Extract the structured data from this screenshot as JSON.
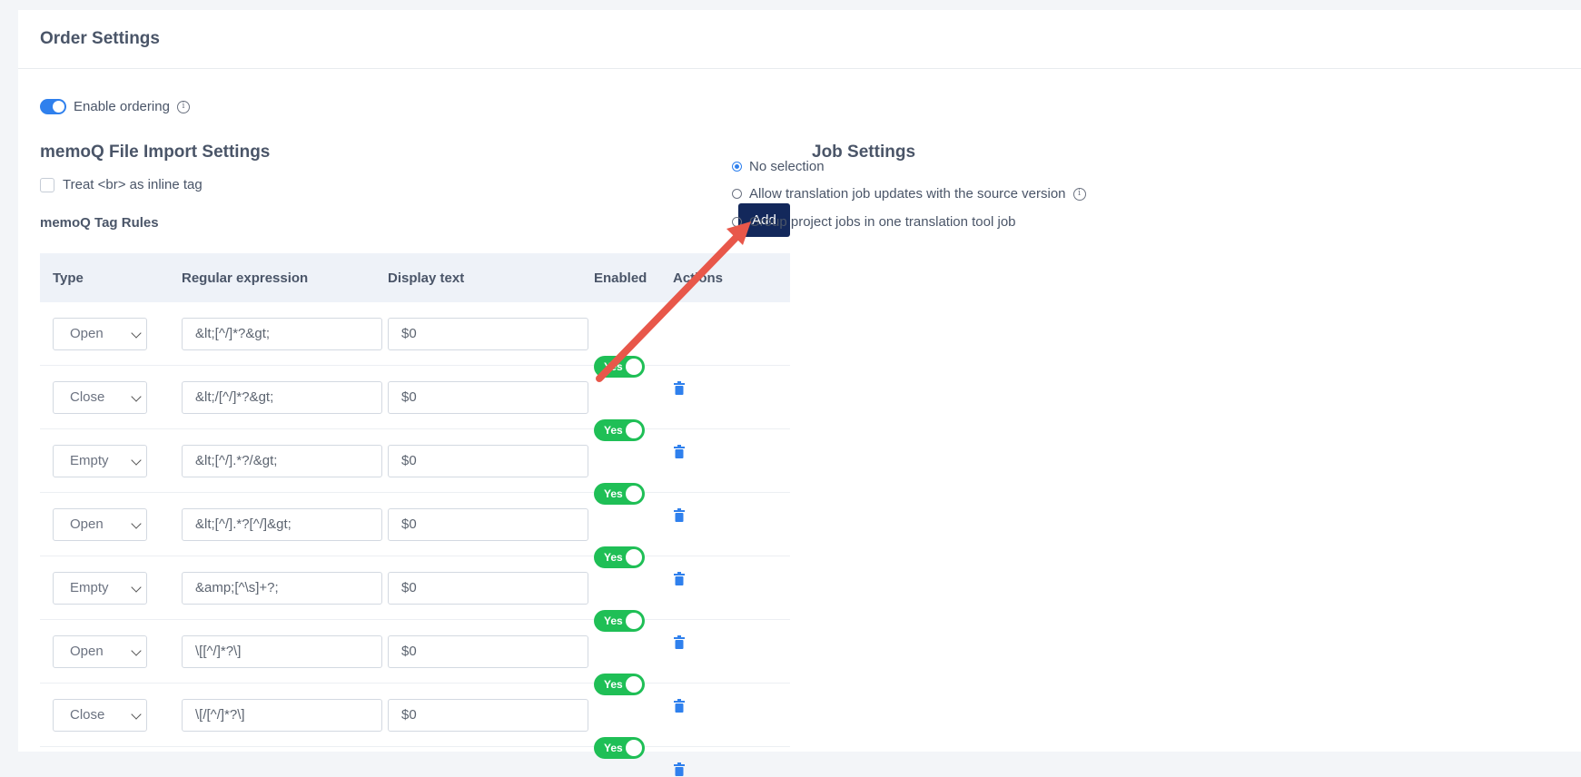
{
  "header": {
    "title": "Order Settings"
  },
  "enable_ordering": {
    "label": "Enable ordering",
    "enabled": true
  },
  "memoq_import": {
    "title": "memoQ File Import Settings",
    "treat_br_label": "Treat <br> as inline tag",
    "treat_br_checked": false
  },
  "tag_rules": {
    "title": "memoQ Tag Rules",
    "add_label": "Add",
    "columns": [
      "Type",
      "Regular expression",
      "Display text",
      "Enabled",
      "Actions"
    ],
    "rows": [
      {
        "type": "Open",
        "regex": "&lt;[^/]*?&gt;",
        "display": "$0",
        "enabled": "Yes"
      },
      {
        "type": "Close",
        "regex": "&lt;/[^/]*?&gt;",
        "display": "$0",
        "enabled": "Yes"
      },
      {
        "type": "Empty",
        "regex": "&lt;[^/].*?/&gt;",
        "display": "$0",
        "enabled": "Yes"
      },
      {
        "type": "Open",
        "regex": "&lt;[^/].*?[^/]&gt;",
        "display": "$0",
        "enabled": "Yes"
      },
      {
        "type": "Empty",
        "regex": "&amp;[^\\s]+?;",
        "display": "$0",
        "enabled": "Yes"
      },
      {
        "type": "Open",
        "regex": "\\[[^/]*?\\]",
        "display": "$0",
        "enabled": "Yes"
      },
      {
        "type": "Close",
        "regex": "\\[/[^/]*?\\]",
        "display": "$0",
        "enabled": "Yes"
      }
    ]
  },
  "job_settings": {
    "title": "Job Settings",
    "options": [
      {
        "label": "No selection",
        "selected": true,
        "info": false
      },
      {
        "label": "Allow translation job updates with the source version",
        "selected": false,
        "info": true
      },
      {
        "label": "Group project jobs in one translation tool job",
        "selected": false,
        "info": false
      }
    ]
  },
  "colors": {
    "accent": "#2f80ed",
    "add_button": "#13285b",
    "toggle_on": "#1fbf56",
    "annotation_arrow": "#e8574a"
  },
  "icons": {
    "info": "info-icon",
    "trash": "trash-icon",
    "chevron": "chevron-down-icon"
  }
}
